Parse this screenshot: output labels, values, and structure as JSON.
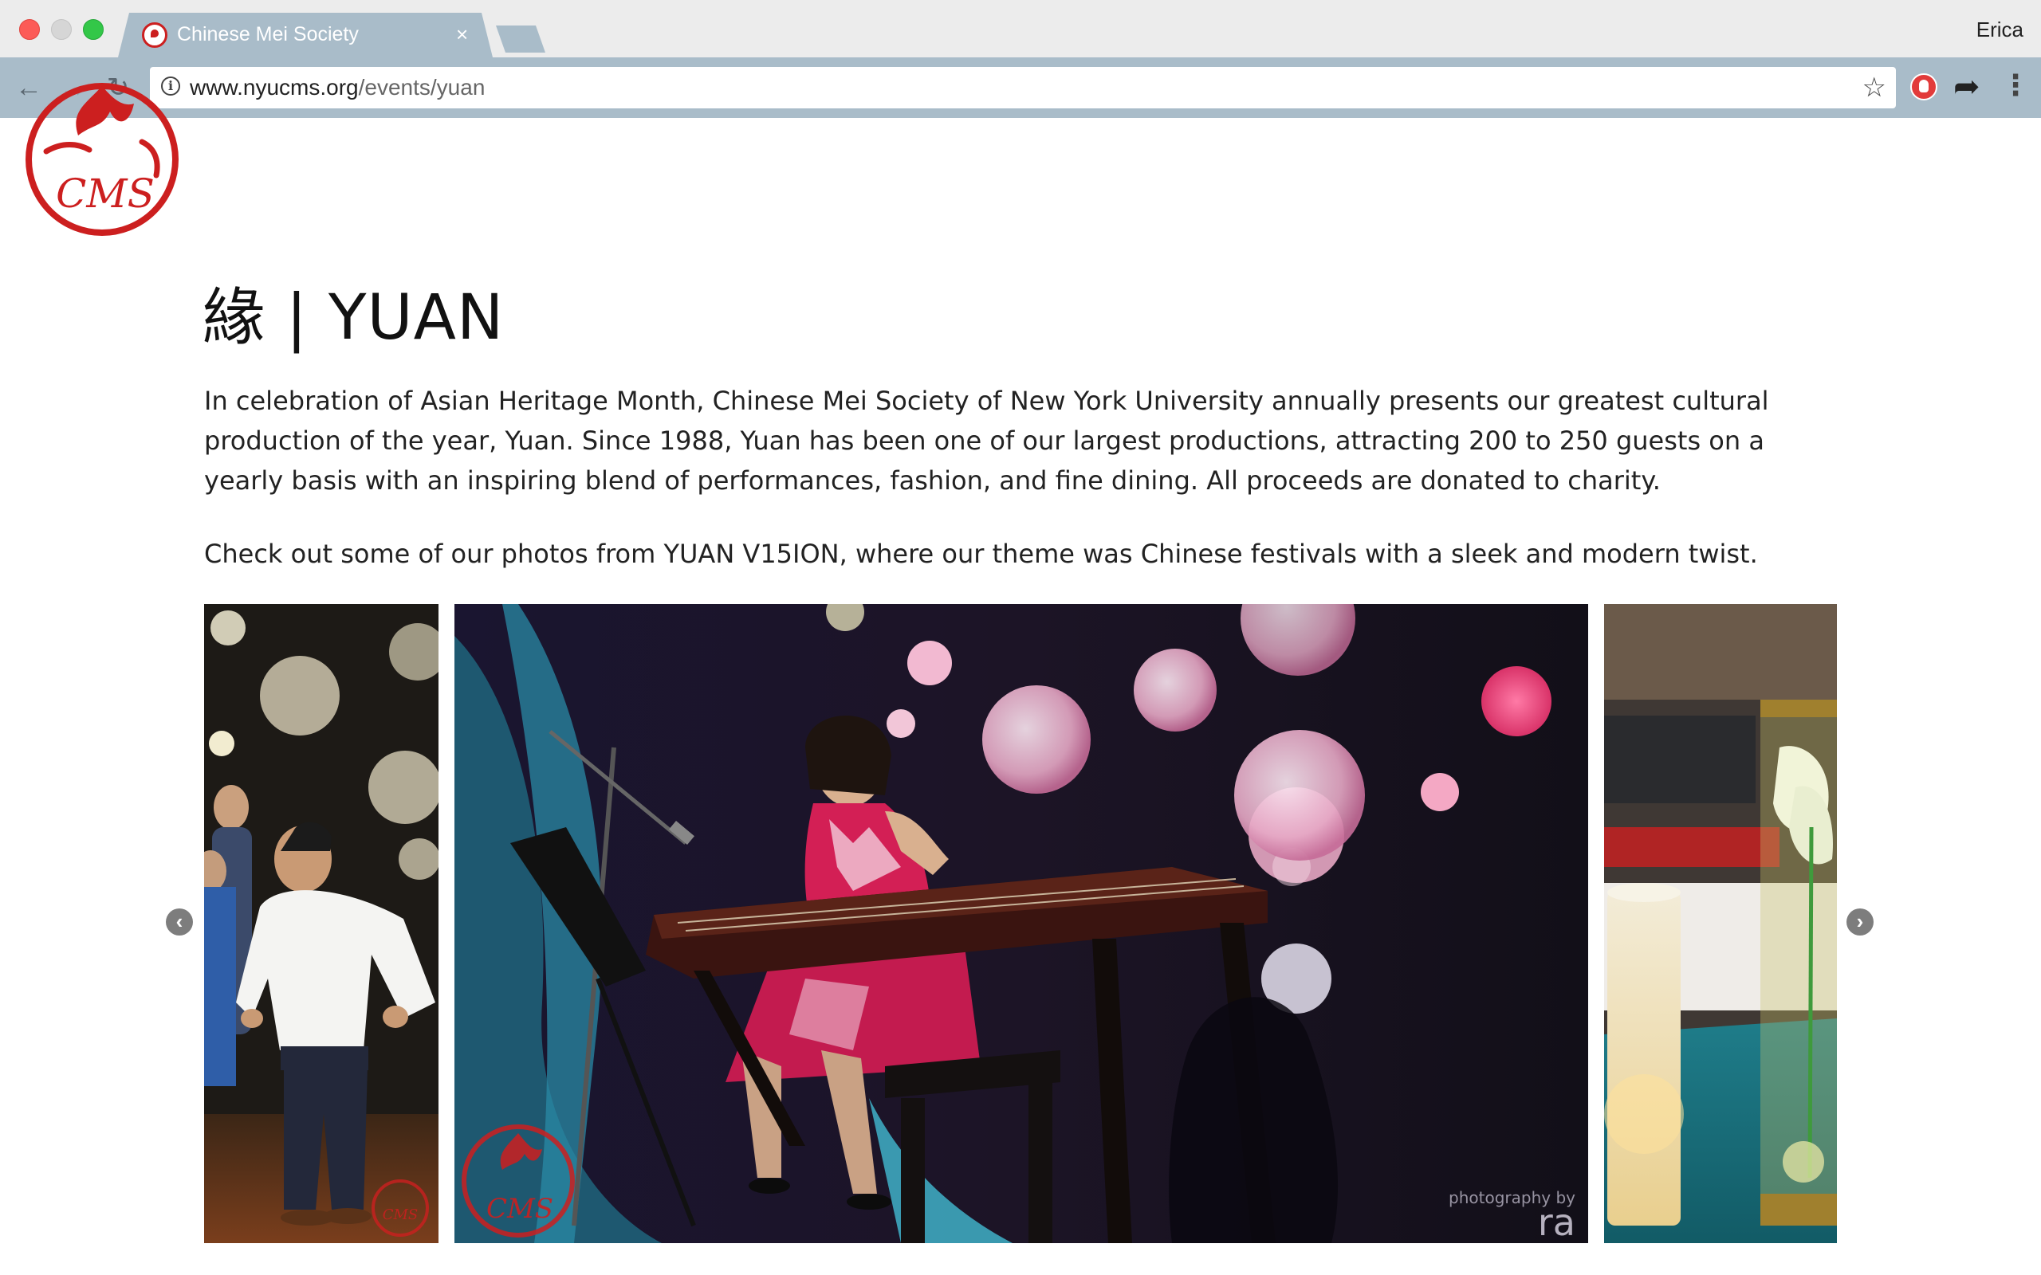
{
  "browser": {
    "tab_title": "Chinese Mei Society",
    "tab_close": "×",
    "profile_name": "Erica",
    "url_host": "www.nyucms.org",
    "url_path": "/events/yuan",
    "info_glyph": "i",
    "star_glyph": "☆",
    "share_glyph": "➦",
    "menu_glyph": "⋮",
    "back_glyph": "←",
    "forward_glyph": "→",
    "reload_glyph": "↻"
  },
  "page": {
    "logo_text": "CMS",
    "title": "緣 | YUAN",
    "intro": "In celebration of Asian Heritage Month, Chinese Mei Society of New York University annually presents our greatest cultural production of the year, Yuan. Since 1988, Yuan has been one of our largest productions, attracting 200 to 250 guests on a yearly basis with an inspiring blend of performances, fashion, and fine dining. All proceeds are donated to charity.",
    "photos_note": "Check out some of our photos from YUAN V15ION, where our theme was Chinese festivals with a sleek and modern twist."
  },
  "carousel": {
    "prev_glyph": "‹",
    "next_glyph": "›",
    "watermark_left": "CMS",
    "watermark_main": "CMS",
    "credit_small": "photography by",
    "credit_large": "ra"
  },
  "colors": {
    "brand_red": "#cc1f1f",
    "chrome_tab": "#a9bcc9"
  }
}
